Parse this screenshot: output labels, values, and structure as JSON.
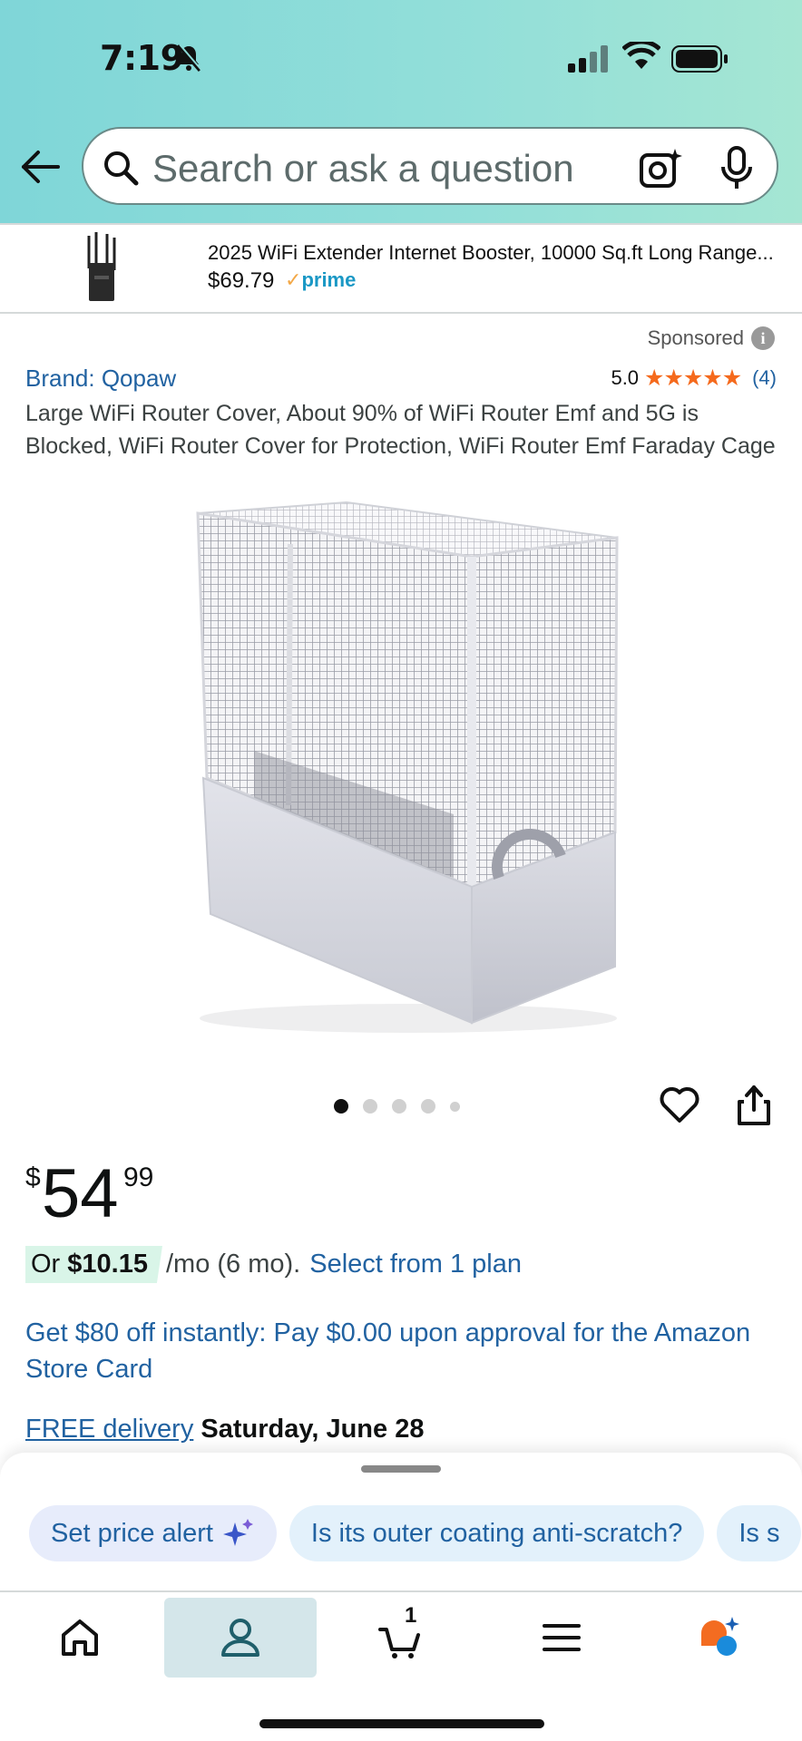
{
  "status_bar": {
    "time": "7:19"
  },
  "search": {
    "placeholder": "Search or ask a question"
  },
  "ad": {
    "title": "2025 WiFi Extender Internet Booster, 10000 Sq.ft Long Range...",
    "price": "$69.79",
    "prime_label": "prime",
    "sponsored_label": "Sponsored"
  },
  "product": {
    "brand": "Brand: Qopaw",
    "rating_value": "5.0",
    "stars": "★★★★★",
    "rating_count": "(4)",
    "title": "Large WiFi Router Cover, About 90% of WiFi Router Emf and 5G is Blocked, WiFi Router Cover for Protection, WiFi Router Emf Faraday Cage",
    "image_count": 5,
    "active_image_index": 0,
    "price_symbol": "$",
    "price_whole": "54",
    "price_fraction": "99",
    "monthly_prefix": "Or ",
    "monthly_amount": "$10.15",
    "monthly_suffix": "/mo (6 mo).",
    "plan_link": "Select from 1 plan",
    "card_offer": "Get $80 off instantly: Pay $0.00 upon approval for the Amazon Store Card",
    "delivery_label": "FREE delivery",
    "delivery_date": "Saturday, June 28"
  },
  "chips": [
    {
      "label": "Set price alert"
    },
    {
      "label": "Is its outer coating anti-scratch?"
    },
    {
      "label": "Is s"
    }
  ],
  "nav": {
    "cart_count": "1",
    "active": "account"
  },
  "colors": {
    "link": "#2162a1",
    "star": "#f56a1d",
    "prime": "#1a98c5",
    "monthly_badge": "#d9f5e8",
    "chip_bg": "#e3f1fb"
  }
}
